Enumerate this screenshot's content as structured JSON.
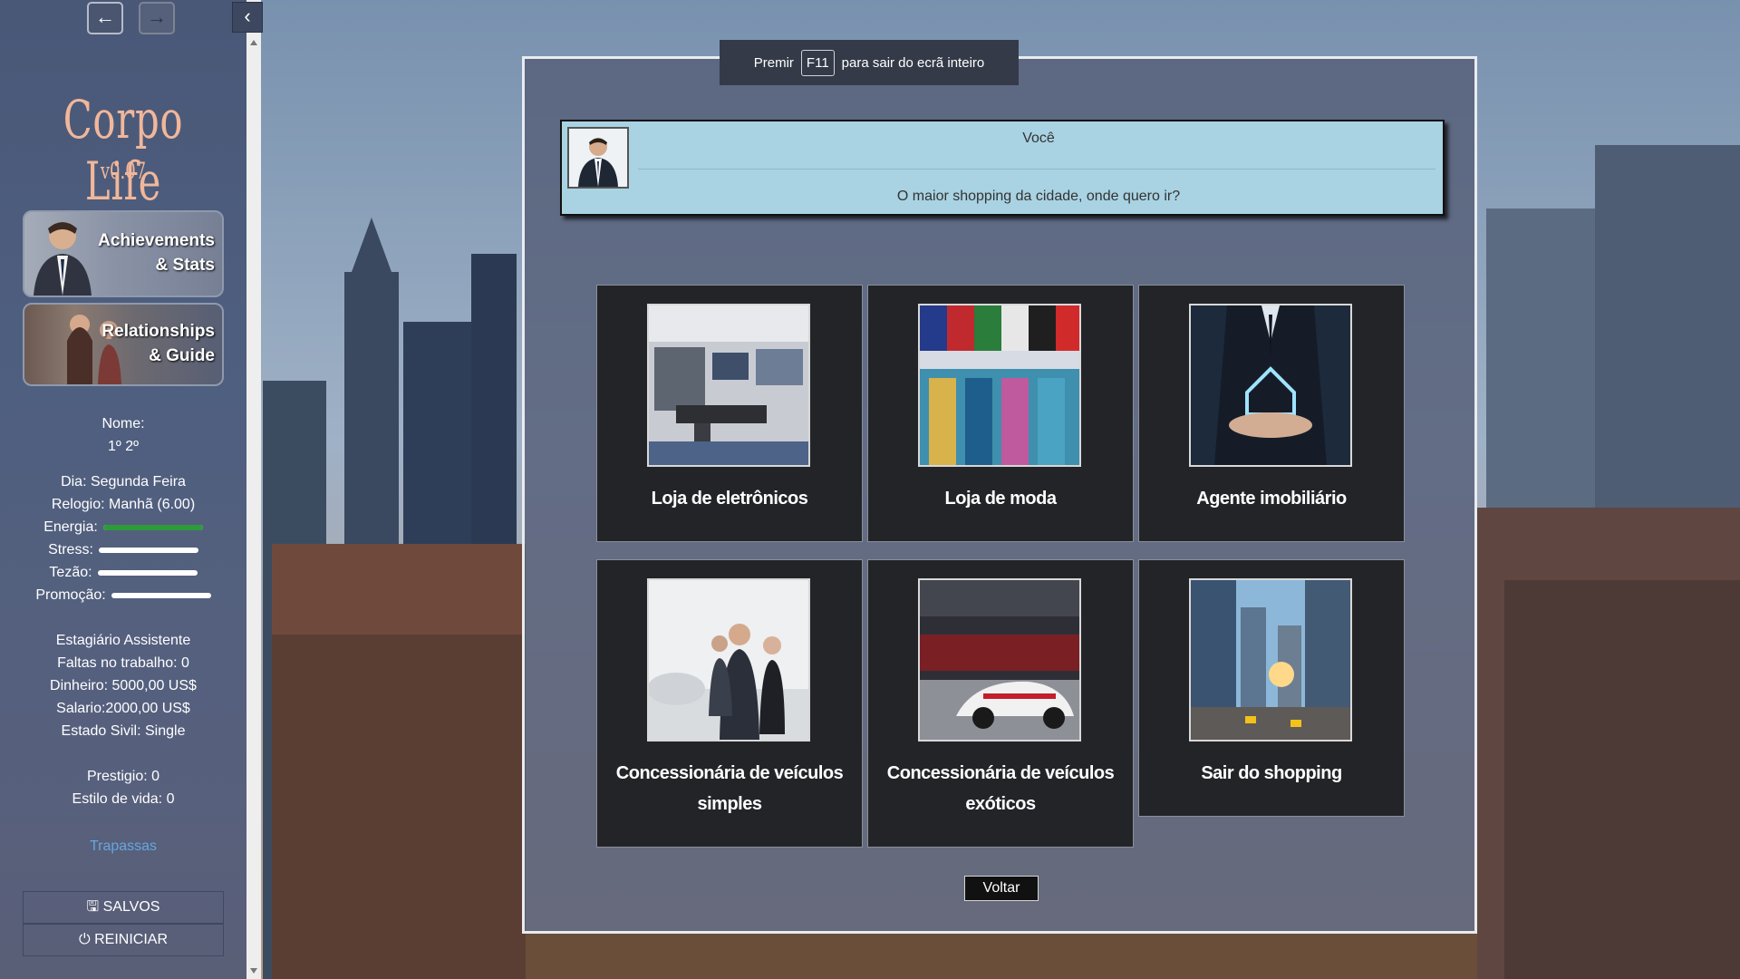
{
  "sidebar": {
    "back_icon": "arrow-left-icon",
    "forward_icon": "arrow-right-icon",
    "collapse_icon": "chevron-left-icon",
    "game_title": "Corpo Life",
    "game_version": "v0.07",
    "achievements_card": {
      "line1": "Achievements",
      "line2": "& Stats"
    },
    "relationships_card": {
      "line1": "Relationships",
      "line2": "& Guide"
    },
    "stats": {
      "name_label": "Nome:",
      "name_value": "1º 2º",
      "day": "Dia: Segunda Feira",
      "clock": "Relogio: Manhã (6.00)",
      "energy_label": "Energia:",
      "energy_level": 1.0,
      "stress_label": "Stress:",
      "stress_level": 0.0,
      "lust_label": "Tezão:",
      "lust_level": 0.0,
      "promotion_label": "Promoção:",
      "promotion_level": 0.0,
      "job": "Estagiário Assistente",
      "absences": "Faltas no trabalho: 0",
      "money": "Dinheiro: 5000,00 US$",
      "salary": "Salario:2000,00 US$",
      "civil_status": "Estado Sivil: Single",
      "prestige": "Prestigio: 0",
      "lifestyle": "Estilo de vida: 0"
    },
    "cheats_link": "Trapassas",
    "save_button": "SALVOS",
    "restart_button": "REINICIAR",
    "energy_color": "#2e9a3a"
  },
  "fullscreen_toast": {
    "before": "Premir",
    "key": "F11",
    "after": "para sair do ecrã inteiro"
  },
  "dialogue": {
    "speaker": "Você",
    "text": "O maior shopping da cidade, onde quero ir?"
  },
  "options": [
    {
      "label": "Loja de eletrônicos",
      "icon": "electronics-store-image"
    },
    {
      "label": "Loja de moda",
      "icon": "clothing-store-image"
    },
    {
      "label": "Agente imobiliário",
      "icon": "real-estate-agent-image"
    },
    {
      "label": "Concessionária de veículos simples",
      "icon": "car-dealership-image"
    },
    {
      "label": "Concessionária de veículos exóticos",
      "icon": "exotic-car-dealership-image"
    },
    {
      "label": "Sair do shopping",
      "icon": "city-street-image"
    }
  ],
  "back_button": "Voltar"
}
